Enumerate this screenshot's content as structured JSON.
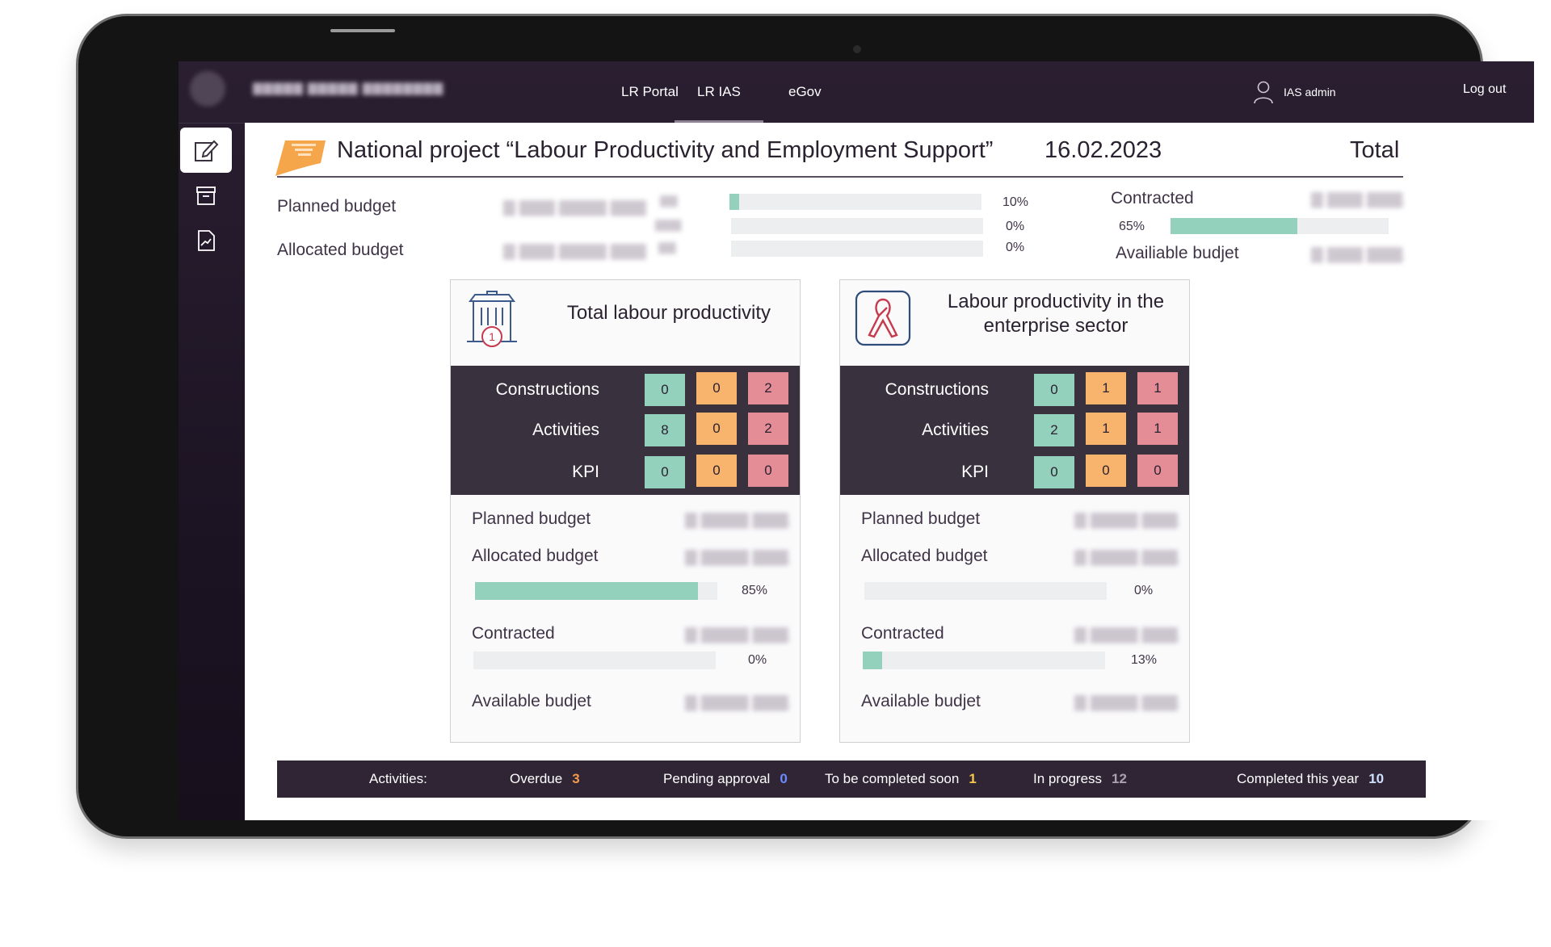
{
  "topbar": {
    "nav": [
      {
        "label": "LR Portal"
      },
      {
        "label": "LR IAS"
      },
      {
        "label": "eGov"
      }
    ],
    "user_label": "IAS admin",
    "logout_label": "Log out"
  },
  "header": {
    "title": "National project “Labour Productivity and Employment Support”",
    "date": "16.02.2023",
    "total_label": "Total"
  },
  "summary": {
    "planned_budget_label": "Planned budget",
    "allocated_budget_label": "Allocated budget",
    "bars": [
      {
        "percent_text": "10%",
        "value": 0.04
      },
      {
        "percent_text": "0%",
        "value": 0
      },
      {
        "percent_text": "0%",
        "value": 0
      }
    ],
    "contracted_label": "Contracted",
    "contracted_percent_text": "65%",
    "contracted_value": 0.58,
    "available_label": "Availiable budjet"
  },
  "cards": [
    {
      "title": "Total labour productivity",
      "rows": [
        {
          "label": "Constructions",
          "green": "0",
          "orange": "0",
          "red": "2"
        },
        {
          "label": "Activities",
          "green": "8",
          "orange": "0",
          "red": "2"
        },
        {
          "label": "KPI",
          "green": "0",
          "orange": "0",
          "red": "0"
        }
      ],
      "planned_budget_label": "Planned budget",
      "allocated_budget_label": "Allocated budget",
      "allocated_percent_text": "85%",
      "allocated_value": 0.92,
      "contracted_label": "Contracted",
      "contracted_percent_text": "0%",
      "contracted_value": 0,
      "available_label": "Available budjet"
    },
    {
      "title": "Labour productivity in the enterprise sector",
      "rows": [
        {
          "label": "Constructions",
          "green": "0",
          "orange": "1",
          "red": "1"
        },
        {
          "label": "Activities",
          "green": "2",
          "orange": "1",
          "red": "1"
        },
        {
          "label": "KPI",
          "green": "0",
          "orange": "0",
          "red": "0"
        }
      ],
      "planned_budget_label": "Planned budget",
      "allocated_budget_label": "Allocated budget",
      "allocated_percent_text": "0%",
      "allocated_value": 0,
      "contracted_label": "Contracted",
      "contracted_percent_text": "13%",
      "contracted_value": 0.08,
      "available_label": "Available budjet"
    }
  ],
  "footer": {
    "label": "Activities:",
    "overdue_label": "Overdue",
    "overdue_value": "3",
    "pending_label": "Pending approval",
    "pending_value": "0",
    "soon_label": "To be completed soon",
    "soon_value": "1",
    "progress_label": "In progress",
    "progress_value": "12",
    "completed_label": "Completed this year",
    "completed_value": "10"
  },
  "colors": {
    "status_green": "#93d1bd",
    "status_orange": "#f8b36c",
    "status_red": "#e48d97",
    "dark_panel": "#3a313f"
  },
  "icons": [
    "edit-icon",
    "archive-icon",
    "report-chart-icon",
    "user-icon",
    "project-ticket-icon",
    "building-icon",
    "ribbon-icon"
  ]
}
